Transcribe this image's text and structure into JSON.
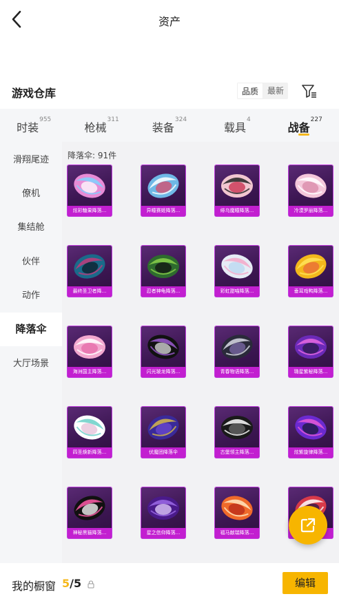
{
  "header": {
    "title": "资产"
  },
  "section": {
    "title": "游戏仓库",
    "sort_options": [
      "品质",
      "最新"
    ],
    "sort_active": "品质"
  },
  "tabs": [
    {
      "label": "时装",
      "count": "955"
    },
    {
      "label": "枪械",
      "count": "311"
    },
    {
      "label": "装备",
      "count": "324"
    },
    {
      "label": "载具",
      "count": "4"
    },
    {
      "label": "战备",
      "count": "227",
      "active": true
    }
  ],
  "sidebar": [
    {
      "label": "滑翔尾迹"
    },
    {
      "label": "僚机"
    },
    {
      "label": "集结舱"
    },
    {
      "label": "伙伴"
    },
    {
      "label": "动作"
    },
    {
      "label": "降落伞",
      "active": true
    },
    {
      "label": "大厅场景"
    }
  ],
  "grid": {
    "count_label": "降落伞: 91件",
    "items": [
      {
        "name": "炫彩糖果降落...",
        "colors": [
          "#e88bd6",
          "#7fd3ff",
          "#ffffff"
        ]
      },
      {
        "name": "异瞳赛姬降落...",
        "colors": [
          "#6fb8e6",
          "#ffffff",
          "#d94b6a"
        ]
      },
      {
        "name": "绯乌魔瞳降落...",
        "colors": [
          "#f2c6d0",
          "#222222",
          "#c72b4b"
        ]
      },
      {
        "name": "冷漠罗丽降落...",
        "colors": [
          "#f4c7da",
          "#ffffff",
          "#d98aa8"
        ]
      },
      {
        "name": "最终圣卫者降...",
        "colors": [
          "#1a6a8a",
          "#c23a7a",
          "#0d1d2a"
        ]
      },
      {
        "name": "忍者神龟降落...",
        "colors": [
          "#2e6b2e",
          "#8ad04a",
          "#111111"
        ]
      },
      {
        "name": "彩虹甜喵降落...",
        "colors": [
          "#e6ecf5",
          "#f3a8c8",
          "#b8d8f0"
        ]
      },
      {
        "name": "垂耳戏鸭降落...",
        "colors": [
          "#f3b81c",
          "#ffe35a",
          "#ea6a3a"
        ]
      },
      {
        "name": "海洲国主降落...",
        "colors": [
          "#f3a8cf",
          "#ffffff",
          "#e66aa8"
        ]
      },
      {
        "name": "闪光玻龙降落...",
        "colors": [
          "#111111",
          "#9b5ad0",
          "#dddddd"
        ]
      },
      {
        "name": "青春物语降落...",
        "colors": [
          "#2a2a3a",
          "#d9d9e6",
          "#7c6aa8"
        ]
      },
      {
        "name": "璐星紫秘降落...",
        "colors": [
          "#6b2ab8",
          "#e76ae0",
          "#2a1a4a"
        ]
      },
      {
        "name": "四圣焕新降落...",
        "colors": [
          "#ffffff",
          "#6ad0c8",
          "#e6c0d8"
        ]
      },
      {
        "name": "伏魔团降落伞",
        "colors": [
          "#3a2a9a",
          "#d6b84a",
          "#6b4ad0"
        ]
      },
      {
        "name": "古堡领主降落...",
        "colors": [
          "#1a1a1a",
          "#ffffff",
          "#6a6a6a"
        ]
      },
      {
        "name": "炫紫旋律降落...",
        "colors": [
          "#6b2ad0",
          "#e65ad6",
          "#1a1a3a"
        ]
      },
      {
        "name": "神秘黑猫降落...",
        "colors": [
          "#111111",
          "#ff5aa8",
          "#ffffff"
        ]
      },
      {
        "name": "星之信仰降落...",
        "colors": [
          "#4a1a8a",
          "#9b6ae6",
          "#e6d0ff"
        ]
      },
      {
        "name": "福马献瑞降落...",
        "colors": [
          "#f06a2a",
          "#ffe6c0",
          "#b82a1a"
        ]
      },
      {
        "name": "",
        "colors": [
          "#d83a4a",
          "#ffffff",
          "#2a1a4a"
        ]
      }
    ]
  },
  "bottom": {
    "label": "我的橱窗",
    "current": "5",
    "separator": "/",
    "total": "5",
    "edit_label": "编辑"
  },
  "accent_color": "#f7b500"
}
